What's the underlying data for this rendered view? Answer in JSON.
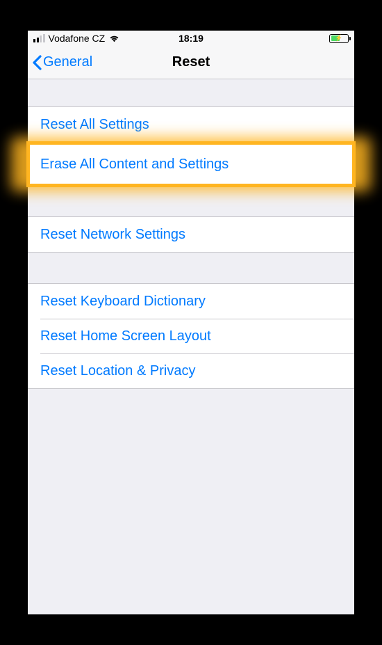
{
  "status": {
    "carrier": "Vodafone CZ",
    "time": "18:19"
  },
  "nav": {
    "back_label": "General",
    "title": "Reset"
  },
  "rows": {
    "reset_all": "Reset All Settings",
    "erase_all": "Erase All Content and Settings",
    "reset_network": "Reset Network Settings",
    "reset_keyboard": "Reset Keyboard Dictionary",
    "reset_home": "Reset Home Screen Layout",
    "reset_location": "Reset Location & Privacy"
  }
}
